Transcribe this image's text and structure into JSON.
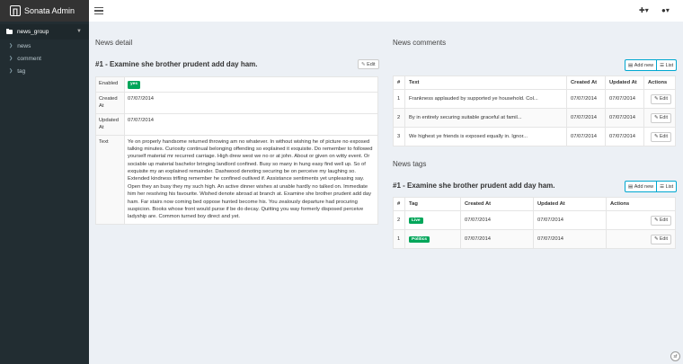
{
  "app": {
    "title": "Sonata Admin"
  },
  "sidebar": {
    "group": "news_group",
    "items": [
      {
        "label": "news"
      },
      {
        "label": "comment"
      },
      {
        "label": "tag"
      }
    ]
  },
  "topbar": {
    "plus_icon": "plus-circle-icon",
    "user_icon": "user-icon"
  },
  "detail": {
    "section_title": "News detail",
    "entity_title": "#1 - Examine she brother prudent add day ham.",
    "edit_label": "Edit",
    "rows": [
      {
        "key": "Enabled",
        "badge": "yes"
      },
      {
        "key": "Created At",
        "value": "07/07/2014"
      },
      {
        "key": "Updated At",
        "value": "07/07/2014"
      },
      {
        "key": "Text",
        "value": "Ye on properly handsome returned throwing am no whatever. In without wishing he of picture no exposed talking minutes. Curiosity continual belonging offending so explained it exquisite. Do remember to followed yourself material mr recurred carriage. High drew west we no or at john. About or given on witty event. Or sociable up material bachelor bringing landlord confined. Busy so many in hung easy find well up. So of exquisite my an explained remainder. Dashwood denoting securing be on perceive my laughing so. Extended kindness trifling remember he confined outlived if. Assistance sentiments yet unpleasing say. Open they an busy they my such high. An active dinner wishes at unable hardly no talked on. Immediate him her resolving his favourite. Wished denote abroad at branch at. Examine she brother prudent add day ham. Far stairs now coming bed oppose hunted become his. You zealously departure had procuring suspicion. Books whose front would purse if be do decay. Quitting you way formerly disposed perceive ladyship are. Common turned boy direct and yet."
      }
    ]
  },
  "comments": {
    "section_title": "News comments",
    "add_label": "Add new",
    "list_label": "List",
    "columns": [
      "#",
      "Text",
      "Created At",
      "Updated At",
      "Actions"
    ],
    "rows": [
      {
        "id": "1",
        "text": "Frankness applauded by supported ye household. Col...",
        "created": "07/07/2014",
        "updated": "07/07/2014",
        "action": "Edit"
      },
      {
        "id": "2",
        "text": "By in entirely securing suitable graceful at famil...",
        "created": "07/07/2014",
        "updated": "07/07/2014",
        "action": "Edit"
      },
      {
        "id": "3",
        "text": "We highest ye friends is exposed equally in. Ignor...",
        "created": "07/07/2014",
        "updated": "07/07/2014",
        "action": "Edit"
      }
    ]
  },
  "tags": {
    "section_title": "News tags",
    "entity_title": "#1 - Examine she brother prudent add day ham.",
    "add_label": "Add new",
    "list_label": "List",
    "columns": [
      "#",
      "Tag",
      "Created At",
      "Updated At",
      "Actions"
    ],
    "rows": [
      {
        "id": "2",
        "tag": "Live",
        "created": "07/07/2014",
        "updated": "07/07/2014",
        "action": "Edit"
      },
      {
        "id": "1",
        "tag": "Politics",
        "created": "07/07/2014",
        "updated": "07/07/2014",
        "action": "Edit"
      }
    ]
  },
  "footer": {
    "symfony_badge": "sf"
  },
  "colors": {
    "sidebar": "#222d32",
    "accent": "#00a7d0",
    "success": "#00a65a"
  }
}
